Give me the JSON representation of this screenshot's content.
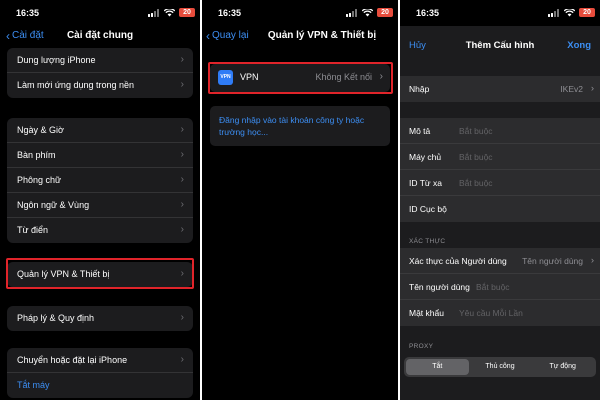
{
  "status_bar": {
    "time": "16:35",
    "battery": "20"
  },
  "panel1": {
    "nav": {
      "back": "Cài đặt",
      "title": "Cài đặt chung"
    },
    "group1": [
      "Dung lượng iPhone",
      "Làm mới ứng dụng trong nền"
    ],
    "group2": [
      "Ngày & Giờ",
      "Bàn phím",
      "Phông chữ",
      "Ngôn ngữ & Vùng",
      "Từ điển"
    ],
    "group3": [
      "Quản lý VPN & Thiết bị"
    ],
    "group4": [
      "Pháp lý & Quy định"
    ],
    "group5": {
      "item": "Chuyển hoặc đặt lại iPhone",
      "action": "Tắt máy"
    }
  },
  "panel2": {
    "nav": {
      "back": "Quay lại",
      "title": "Quản lý VPN & Thiết bị"
    },
    "vpn": {
      "icon_text": "VPN",
      "label": "VPN",
      "status": "Không Kết nối"
    },
    "login_link": "Đăng nhập vào tài khoản công ty hoặc trường học..."
  },
  "panel3": {
    "header": {
      "cancel": "Hủy",
      "title": "Thêm Cấu hình",
      "done": "Xong"
    },
    "type": {
      "label": "Nhập",
      "value": "IKEv2"
    },
    "fields": [
      {
        "label": "Mô tả",
        "placeholder": "Bắt buộc"
      },
      {
        "label": "Máy chủ",
        "placeholder": "Bắt buộc"
      },
      {
        "label": "ID Từ xa",
        "placeholder": "Bắt buộc"
      },
      {
        "label": "ID Cục bộ",
        "placeholder": ""
      }
    ],
    "auth_section": "XÁC THỰC",
    "auth": {
      "method": {
        "label": "Xác thực của Người dùng",
        "value": "Tên người dùng"
      },
      "username": {
        "label": "Tên người dùng",
        "placeholder": "Bắt buộc"
      },
      "password": {
        "label": "Mật khẩu",
        "placeholder": "Yêu cầu Mỗi Lần"
      }
    },
    "proxy_section": "PROXY",
    "proxy_options": [
      "Tắt",
      "Thủ công",
      "Tự động"
    ],
    "proxy_selected": "Tắt"
  },
  "colors": {
    "accent": "#3c8ef3",
    "highlight": "#e0242a",
    "battery": "#e74c3c"
  }
}
